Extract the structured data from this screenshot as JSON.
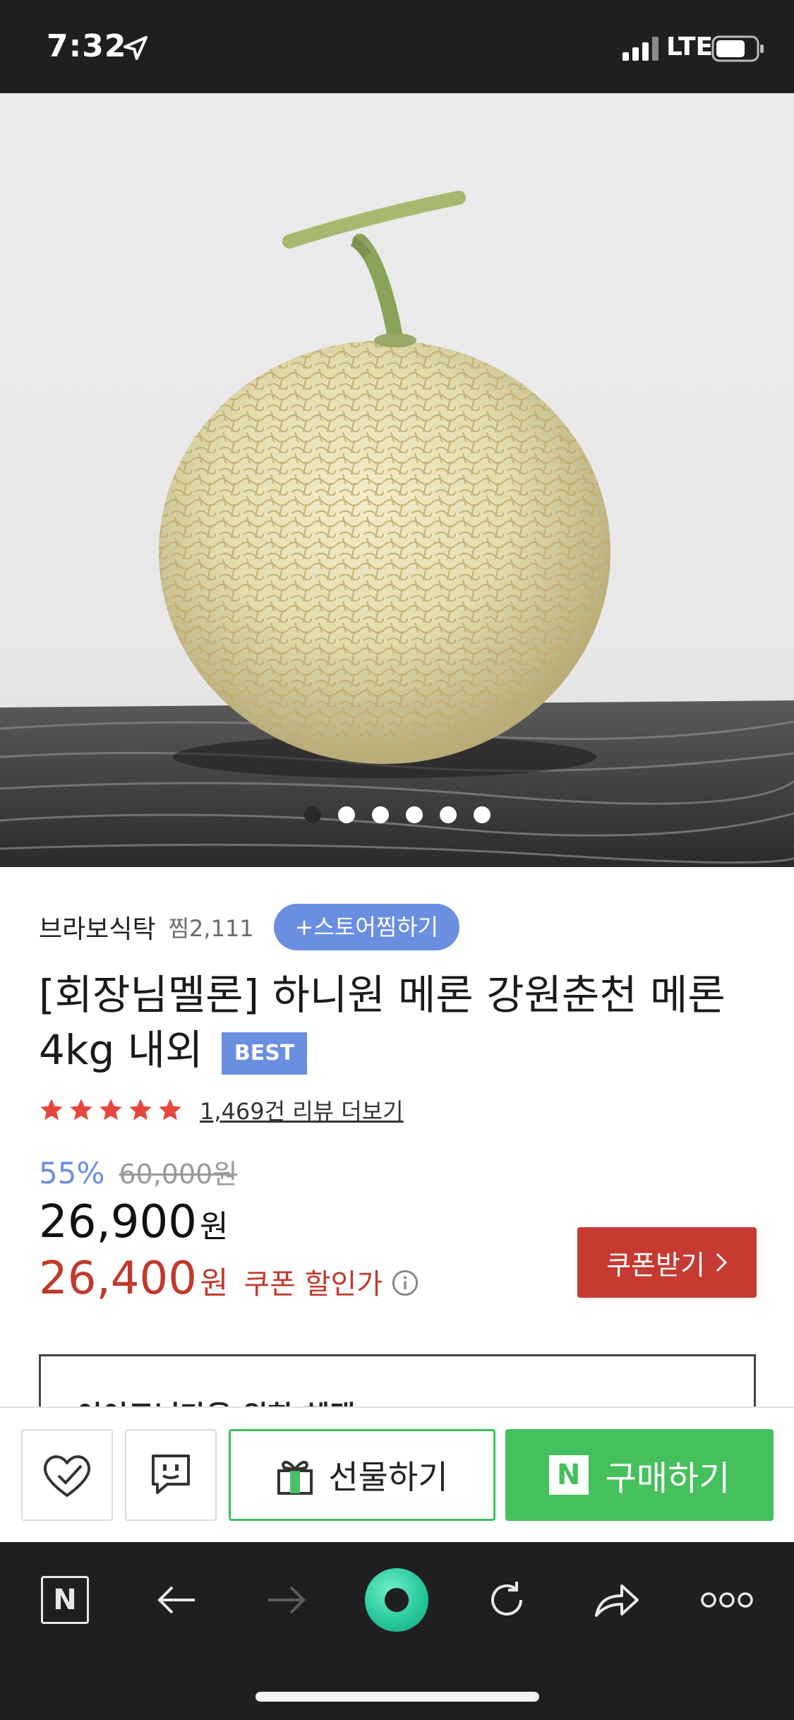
{
  "status_bar": {
    "time": "7:32",
    "network": "LTE",
    "location_icon": "location-arrow-icon",
    "signal_icon": "signal-bars-icon",
    "battery_icon": "battery-icon"
  },
  "hero": {
    "image": "melon-product-photo",
    "carousel_total": 6,
    "carousel_active_index": 0
  },
  "store": {
    "name": "브라보식탁",
    "likes": "찜2,111",
    "fav_button": "+스토어찜하기"
  },
  "product": {
    "title": "[회장님멜론] 하니원 메론 강원춘천 메론 4kg 내외",
    "badge": "BEST",
    "rating_stars": 5,
    "review_link": "1,469건 리뷰 더보기",
    "discount_rate": "55%",
    "original_price": "60,000원",
    "sale_price": "26,900",
    "sale_unit": "원",
    "coupon_price": "26,400",
    "coupon_unit": "원",
    "coupon_label": "쿠폰 할인가",
    "coupon_button": "쿠폰받기",
    "benefit_title": "이이로님만을 위한 혜택"
  },
  "actions": {
    "gift_label": "선물하기",
    "buy_label": "구매하기",
    "npay_mark": "N"
  },
  "browser": {
    "home_mark": "N"
  },
  "colors": {
    "accent_blue": "#6a8ee0",
    "price_red": "#c0392b",
    "coupon_button": "#c63a32",
    "buy_green": "#44c05c",
    "toolbar_dark": "#1f1f21"
  }
}
